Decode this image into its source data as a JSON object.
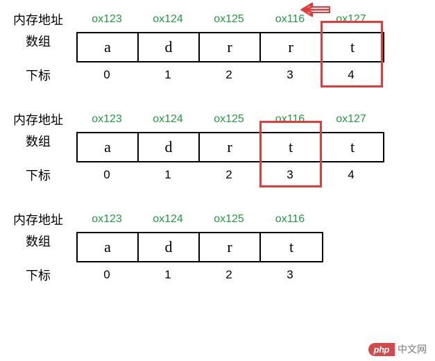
{
  "labels": {
    "memory_address": "内存地址",
    "array": "数组",
    "index": "下标"
  },
  "blocks": [
    {
      "id": 0,
      "cell_count": 5,
      "highlight_index": 4,
      "addresses": [
        "ox123",
        "ox124",
        "ox125",
        "ox116",
        "ox127"
      ],
      "values": [
        "a",
        "d",
        "r",
        "r",
        "t"
      ],
      "indices": [
        "0",
        "1",
        "2",
        "3",
        "4"
      ],
      "show_arrow": true
    },
    {
      "id": 1,
      "cell_count": 5,
      "highlight_index": 3,
      "addresses": [
        "ox123",
        "ox124",
        "ox125",
        "ox116",
        "ox127"
      ],
      "values": [
        "a",
        "d",
        "r",
        "t",
        "t"
      ],
      "indices": [
        "0",
        "1",
        "2",
        "3",
        "4"
      ],
      "show_arrow": false
    },
    {
      "id": 2,
      "cell_count": 4,
      "highlight_index": -1,
      "addresses": [
        "ox123",
        "ox124",
        "ox125",
        "ox116"
      ],
      "values": [
        "a",
        "d",
        "r",
        "t"
      ],
      "indices": [
        "0",
        "1",
        "2",
        "3"
      ],
      "show_arrow": false
    }
  ],
  "watermark": {
    "logo_text": "php",
    "site_text": "中文网"
  }
}
